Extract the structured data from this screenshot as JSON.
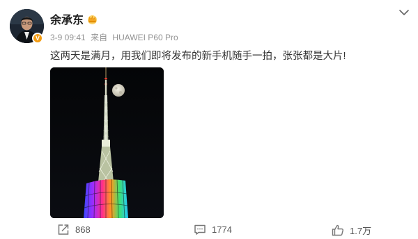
{
  "user": {
    "name": "余承东",
    "crown_icon": "crown-icon",
    "verified_icon": "verified-v-badge-icon",
    "verified_symbol": "V",
    "avatar_icon": "avatar-portrait-icon"
  },
  "post": {
    "date": "3-9 09:41",
    "source_prefix": "来自",
    "source_device": "HUAWEI P60 Pro",
    "text": "这两天是满月，用我们即将发布的新手机随手一拍，张张都是大片!",
    "image_icon": "night-tower-moon-photo"
  },
  "actions": {
    "repost": {
      "icon": "repost-icon",
      "count": "868"
    },
    "comment": {
      "icon": "comment-icon",
      "count": "1774"
    },
    "like": {
      "icon": "thumbs-up-icon",
      "count": "1.7万"
    }
  },
  "menu": {
    "icon": "chevron-down-icon"
  },
  "colors": {
    "verified": "#f39c12",
    "crown": "#f5a623",
    "meta": "#939393"
  }
}
